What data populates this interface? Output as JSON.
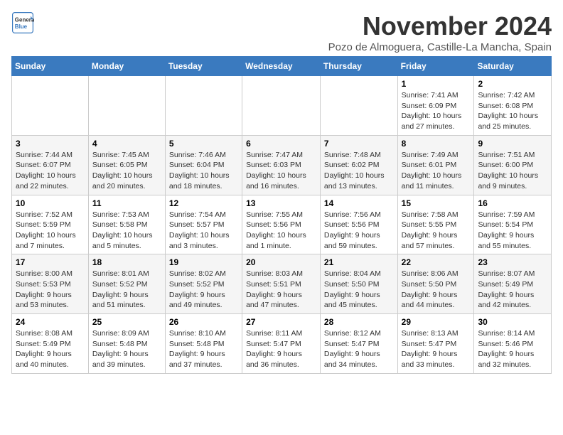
{
  "logo": {
    "general": "General",
    "blue": "Blue"
  },
  "header": {
    "month_title": "November 2024",
    "location": "Pozo de Almoguera, Castille-La Mancha, Spain"
  },
  "days_of_week": [
    "Sunday",
    "Monday",
    "Tuesday",
    "Wednesday",
    "Thursday",
    "Friday",
    "Saturday"
  ],
  "weeks": [
    [
      {
        "day": "",
        "info": ""
      },
      {
        "day": "",
        "info": ""
      },
      {
        "day": "",
        "info": ""
      },
      {
        "day": "",
        "info": ""
      },
      {
        "day": "",
        "info": ""
      },
      {
        "day": "1",
        "info": "Sunrise: 7:41 AM\nSunset: 6:09 PM\nDaylight: 10 hours and 27 minutes."
      },
      {
        "day": "2",
        "info": "Sunrise: 7:42 AM\nSunset: 6:08 PM\nDaylight: 10 hours and 25 minutes."
      }
    ],
    [
      {
        "day": "3",
        "info": "Sunrise: 7:44 AM\nSunset: 6:07 PM\nDaylight: 10 hours and 22 minutes."
      },
      {
        "day": "4",
        "info": "Sunrise: 7:45 AM\nSunset: 6:05 PM\nDaylight: 10 hours and 20 minutes."
      },
      {
        "day": "5",
        "info": "Sunrise: 7:46 AM\nSunset: 6:04 PM\nDaylight: 10 hours and 18 minutes."
      },
      {
        "day": "6",
        "info": "Sunrise: 7:47 AM\nSunset: 6:03 PM\nDaylight: 10 hours and 16 minutes."
      },
      {
        "day": "7",
        "info": "Sunrise: 7:48 AM\nSunset: 6:02 PM\nDaylight: 10 hours and 13 minutes."
      },
      {
        "day": "8",
        "info": "Sunrise: 7:49 AM\nSunset: 6:01 PM\nDaylight: 10 hours and 11 minutes."
      },
      {
        "day": "9",
        "info": "Sunrise: 7:51 AM\nSunset: 6:00 PM\nDaylight: 10 hours and 9 minutes."
      }
    ],
    [
      {
        "day": "10",
        "info": "Sunrise: 7:52 AM\nSunset: 5:59 PM\nDaylight: 10 hours and 7 minutes."
      },
      {
        "day": "11",
        "info": "Sunrise: 7:53 AM\nSunset: 5:58 PM\nDaylight: 10 hours and 5 minutes."
      },
      {
        "day": "12",
        "info": "Sunrise: 7:54 AM\nSunset: 5:57 PM\nDaylight: 10 hours and 3 minutes."
      },
      {
        "day": "13",
        "info": "Sunrise: 7:55 AM\nSunset: 5:56 PM\nDaylight: 10 hours and 1 minute."
      },
      {
        "day": "14",
        "info": "Sunrise: 7:56 AM\nSunset: 5:56 PM\nDaylight: 9 hours and 59 minutes."
      },
      {
        "day": "15",
        "info": "Sunrise: 7:58 AM\nSunset: 5:55 PM\nDaylight: 9 hours and 57 minutes."
      },
      {
        "day": "16",
        "info": "Sunrise: 7:59 AM\nSunset: 5:54 PM\nDaylight: 9 hours and 55 minutes."
      }
    ],
    [
      {
        "day": "17",
        "info": "Sunrise: 8:00 AM\nSunset: 5:53 PM\nDaylight: 9 hours and 53 minutes."
      },
      {
        "day": "18",
        "info": "Sunrise: 8:01 AM\nSunset: 5:52 PM\nDaylight: 9 hours and 51 minutes."
      },
      {
        "day": "19",
        "info": "Sunrise: 8:02 AM\nSunset: 5:52 PM\nDaylight: 9 hours and 49 minutes."
      },
      {
        "day": "20",
        "info": "Sunrise: 8:03 AM\nSunset: 5:51 PM\nDaylight: 9 hours and 47 minutes."
      },
      {
        "day": "21",
        "info": "Sunrise: 8:04 AM\nSunset: 5:50 PM\nDaylight: 9 hours and 45 minutes."
      },
      {
        "day": "22",
        "info": "Sunrise: 8:06 AM\nSunset: 5:50 PM\nDaylight: 9 hours and 44 minutes."
      },
      {
        "day": "23",
        "info": "Sunrise: 8:07 AM\nSunset: 5:49 PM\nDaylight: 9 hours and 42 minutes."
      }
    ],
    [
      {
        "day": "24",
        "info": "Sunrise: 8:08 AM\nSunset: 5:49 PM\nDaylight: 9 hours and 40 minutes."
      },
      {
        "day": "25",
        "info": "Sunrise: 8:09 AM\nSunset: 5:48 PM\nDaylight: 9 hours and 39 minutes."
      },
      {
        "day": "26",
        "info": "Sunrise: 8:10 AM\nSunset: 5:48 PM\nDaylight: 9 hours and 37 minutes."
      },
      {
        "day": "27",
        "info": "Sunrise: 8:11 AM\nSunset: 5:47 PM\nDaylight: 9 hours and 36 minutes."
      },
      {
        "day": "28",
        "info": "Sunrise: 8:12 AM\nSunset: 5:47 PM\nDaylight: 9 hours and 34 minutes."
      },
      {
        "day": "29",
        "info": "Sunrise: 8:13 AM\nSunset: 5:47 PM\nDaylight: 9 hours and 33 minutes."
      },
      {
        "day": "30",
        "info": "Sunrise: 8:14 AM\nSunset: 5:46 PM\nDaylight: 9 hours and 32 minutes."
      }
    ]
  ]
}
